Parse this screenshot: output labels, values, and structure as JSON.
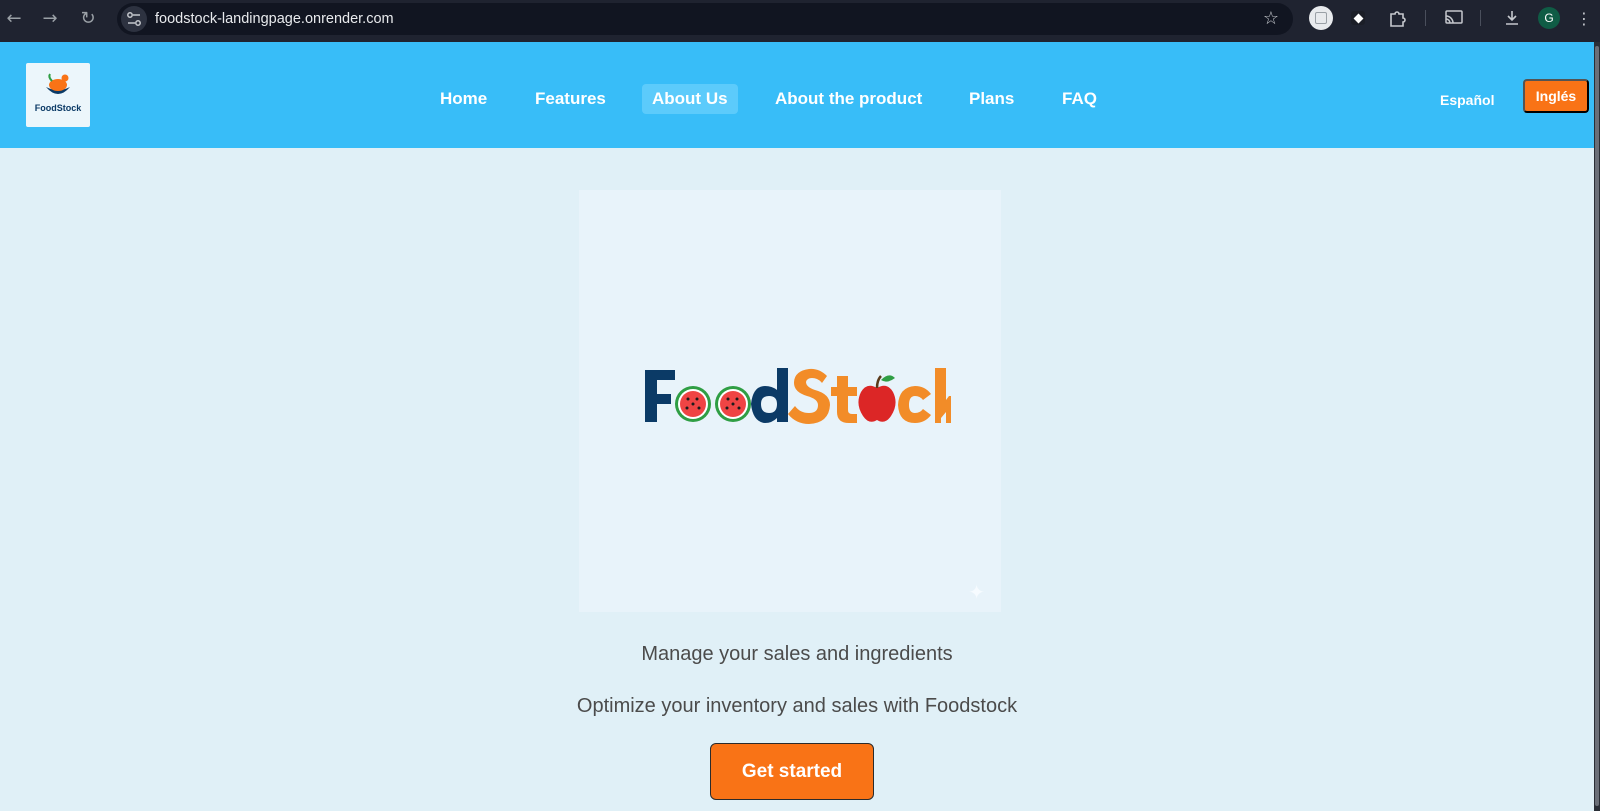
{
  "browser": {
    "url": "foodstock-landingpage.onrender.com",
    "profile_initial": "G"
  },
  "header": {
    "logo_text": "FoodStock",
    "nav": [
      {
        "label": "Home"
      },
      {
        "label": "Features"
      },
      {
        "label": "About Us",
        "active": true
      },
      {
        "label": "About the product"
      },
      {
        "label": "Plans"
      },
      {
        "label": "FAQ"
      }
    ],
    "lang_es": "Español",
    "lang_en": "Inglés"
  },
  "hero": {
    "brand_part1": "Food",
    "brand_part2": "Stock",
    "tagline": "Manage your sales and ingredients",
    "subtitle": "Optimize your inventory and sales with Foodstock",
    "cta_label": "Get started"
  },
  "colors": {
    "header_bg": "#38bdf8",
    "accent": "#f97316",
    "page_bg": "#e0f0f7",
    "brand_dark": "#0b3a66"
  }
}
